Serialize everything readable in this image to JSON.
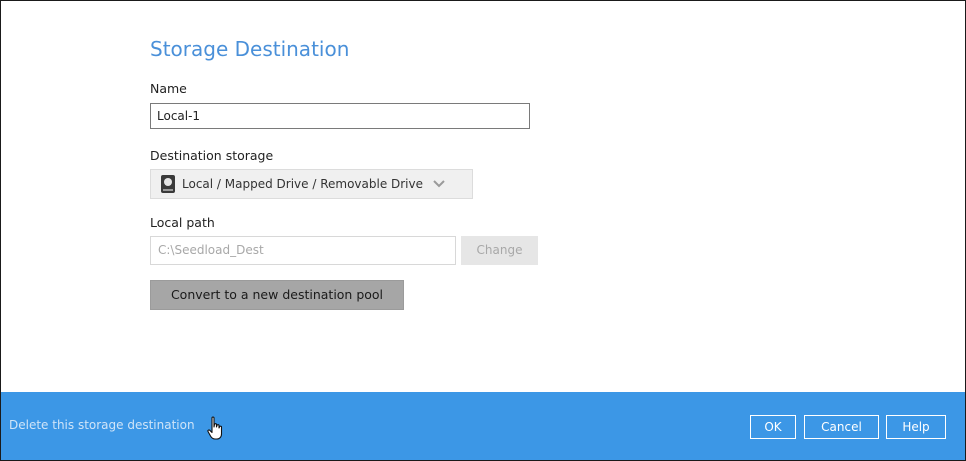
{
  "dialog": {
    "title": "Storage Destination",
    "name_label": "Name",
    "name_value": "Local-1",
    "destination_label": "Destination storage",
    "destination_value": "Local / Mapped Drive / Removable Drive",
    "destination_icon": "drive-icon",
    "local_path_label": "Local path",
    "local_path_placeholder": "C:\\Seedload_Dest",
    "change_label": "Change",
    "convert_label": "Convert to a new destination pool"
  },
  "footer": {
    "delete_link": "Delete this storage destination",
    "ok_label": "OK",
    "cancel_label": "Cancel",
    "help_label": "Help"
  },
  "colors": {
    "title": "#4a90d9",
    "footer_bg": "#3c97e6",
    "convert_bg": "#a6a6a6"
  }
}
